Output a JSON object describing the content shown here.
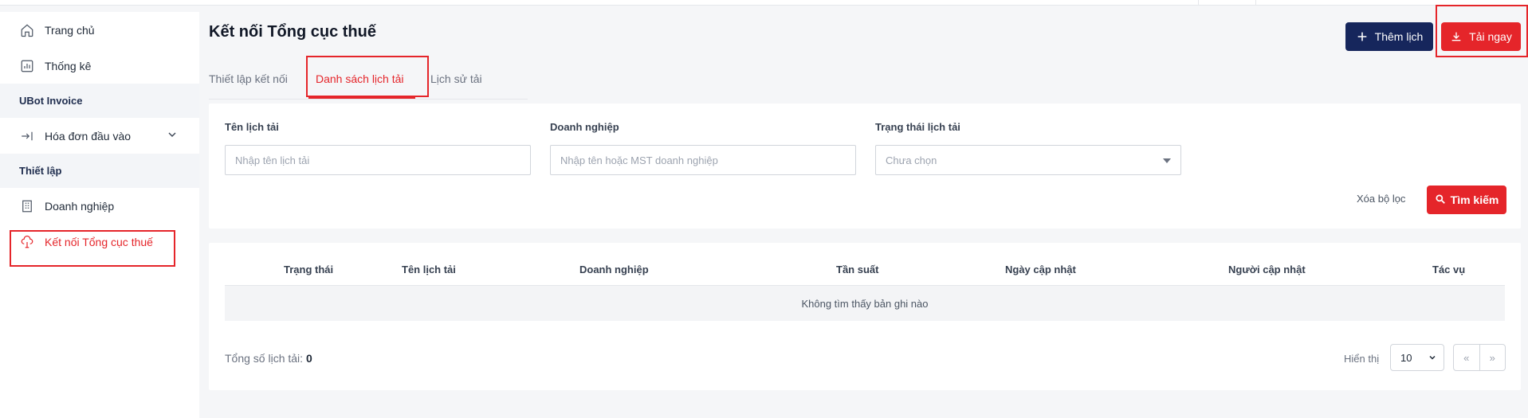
{
  "sidebar": {
    "items": [
      {
        "label": "Trang chủ",
        "icon": "home-icon"
      },
      {
        "label": "Thống kê",
        "icon": "chart-icon"
      }
    ],
    "section_invoice": "UBot Invoice",
    "invoice_item": {
      "label": "Hóa đơn đầu vào",
      "icon": "arrow-in-icon"
    },
    "section_settings": "Thiết lập",
    "settings_items": [
      {
        "label": "Doanh nghiệp",
        "icon": "building-icon"
      },
      {
        "label": "Kết nối Tổng cục thuế",
        "icon": "cloud-upload-icon"
      }
    ]
  },
  "header": {
    "title": "Kết nối Tổng cục thuế",
    "add_label": "Thêm lịch",
    "download_label": "Tải ngay"
  },
  "tabs": [
    {
      "label": "Thiết lập kết nối"
    },
    {
      "label": "Danh sách lịch tải"
    },
    {
      "label": "Lịch sử tải"
    }
  ],
  "filters": {
    "name_label": "Tên lịch tải",
    "name_placeholder": "Nhập tên lịch tải",
    "company_label": "Doanh nghiệp",
    "company_placeholder": "Nhập tên hoặc MST doanh nghiệp",
    "status_label": "Trạng thái lịch tải",
    "status_value": "Chưa chọn",
    "clear_label": "Xóa bộ lọc",
    "search_label": "Tìm kiếm"
  },
  "table": {
    "columns": [
      "Trạng thái",
      "Tên lịch tải",
      "Doanh nghiệp",
      "Tần suất",
      "Ngày cập nhật",
      "Người cập nhật",
      "Tác vụ"
    ],
    "empty_text": "Không tìm thấy bản ghi nào",
    "total_label": "Tổng số lịch tải:",
    "total_value": "0",
    "show_label": "Hiển thị",
    "page_size": "10",
    "prev": "«",
    "next": "»"
  },
  "colors": {
    "accent": "#e5252a",
    "navy": "#16265c"
  }
}
